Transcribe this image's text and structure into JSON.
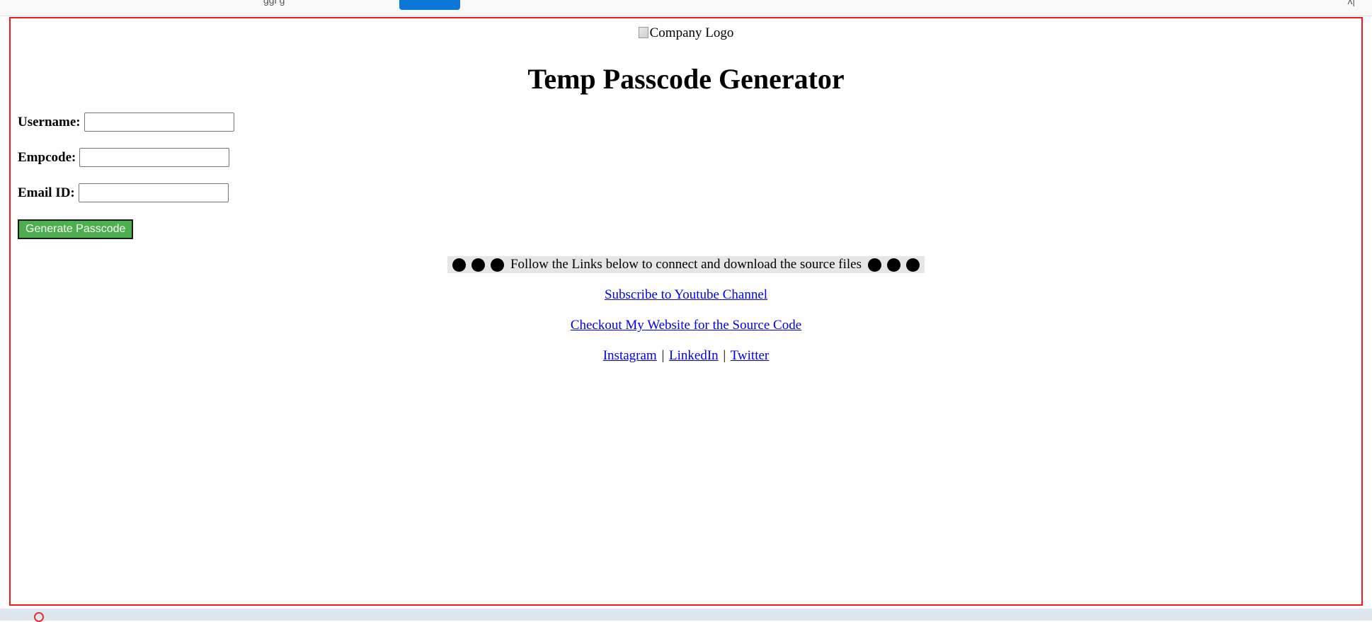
{
  "logo": {
    "alt": "Company Logo"
  },
  "page": {
    "title": "Temp Passcode Generator"
  },
  "form": {
    "username": {
      "label": "Username:",
      "value": ""
    },
    "empcode": {
      "label": "Empcode:",
      "value": ""
    },
    "email": {
      "label": "Email ID:",
      "value": ""
    },
    "submit_label": "Generate Passcode"
  },
  "follow": {
    "text": "Follow the Links below to connect and download the source files"
  },
  "links": {
    "youtube": "Subscribe to Youtube Channel",
    "website": "Checkout My Website for the Source Code",
    "instagram": "Instagram",
    "linkedin": "LinkedIn",
    "twitter": "Twitter",
    "separator": "|"
  },
  "colors": {
    "frame_border": "#ee1c1c",
    "button_bg": "#4cae4c",
    "link": "#0000ee",
    "follow_band": "#e6e6e6"
  }
}
